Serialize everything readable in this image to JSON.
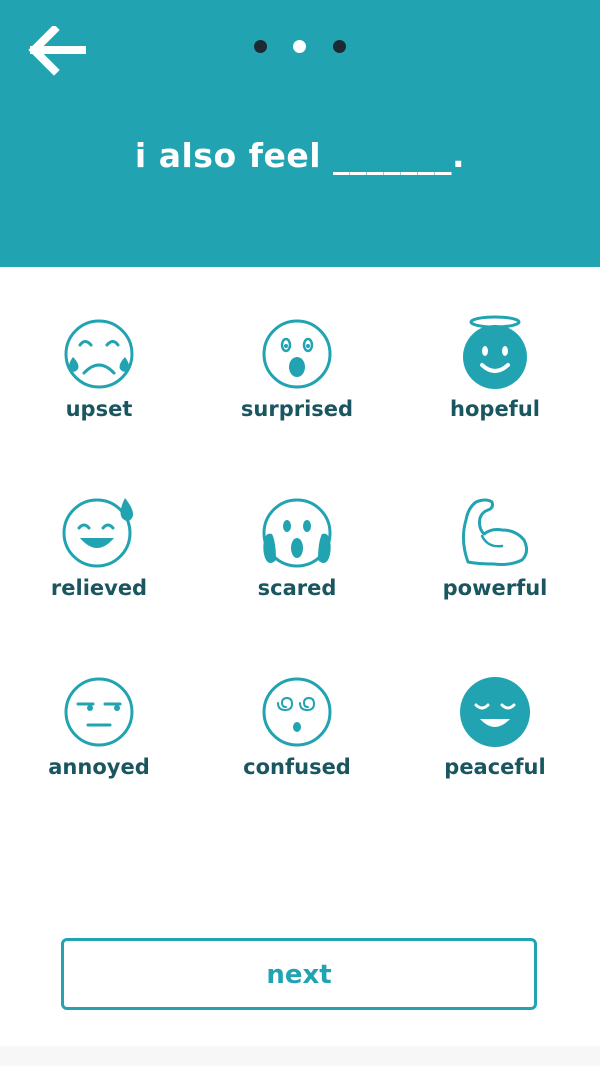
{
  "header": {
    "title": "i also feel _______.",
    "background": "#22a3b1",
    "back_icon": "arrow-left-icon",
    "pagination": {
      "total": 3,
      "current": 2
    }
  },
  "emotions": [
    {
      "id": "upset",
      "label": "upset",
      "icon": "crying-face-icon"
    },
    {
      "id": "surprised",
      "label": "surprised",
      "icon": "surprised-face-icon"
    },
    {
      "id": "hopeful",
      "label": "hopeful",
      "icon": "halo-face-icon"
    },
    {
      "id": "relieved",
      "label": "relieved",
      "icon": "sweat-smile-face-icon"
    },
    {
      "id": "scared",
      "label": "scared",
      "icon": "screaming-face-icon"
    },
    {
      "id": "powerful",
      "label": "powerful",
      "icon": "flexed-bicep-icon"
    },
    {
      "id": "annoyed",
      "label": "annoyed",
      "icon": "unamused-face-icon"
    },
    {
      "id": "confused",
      "label": "confused",
      "icon": "dizzy-face-icon"
    },
    {
      "id": "peaceful",
      "label": "peaceful",
      "icon": "relaxed-face-icon"
    }
  ],
  "next_button": {
    "label": "next"
  },
  "colors": {
    "accent": "#22a3b1",
    "label_text": "#1a5660",
    "dot_active": "#ffffff",
    "dot_inactive": "#1c2b33"
  }
}
